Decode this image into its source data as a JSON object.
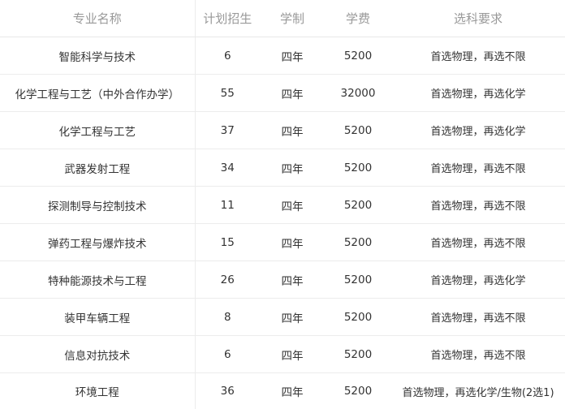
{
  "table": {
    "headers": [
      "专业名称",
      "计划招生",
      "学制",
      "学费",
      "选科要求"
    ],
    "rows": [
      {
        "name": "智能科学与技术",
        "plan": "6",
        "duration": "四年",
        "tuition": "5200",
        "requirement": "首选物理，再选不限"
      },
      {
        "name": "化学工程与工艺（中外合作办学）",
        "plan": "55",
        "duration": "四年",
        "tuition": "32000",
        "requirement": "首选物理，再选化学"
      },
      {
        "name": "化学工程与工艺",
        "plan": "37",
        "duration": "四年",
        "tuition": "5200",
        "requirement": "首选物理，再选化学"
      },
      {
        "name": "武器发射工程",
        "plan": "34",
        "duration": "四年",
        "tuition": "5200",
        "requirement": "首选物理，再选不限"
      },
      {
        "name": "探测制导与控制技术",
        "plan": "11",
        "duration": "四年",
        "tuition": "5200",
        "requirement": "首选物理，再选不限"
      },
      {
        "name": "弹药工程与爆炸技术",
        "plan": "15",
        "duration": "四年",
        "tuition": "5200",
        "requirement": "首选物理，再选不限"
      },
      {
        "name": "特种能源技术与工程",
        "plan": "26",
        "duration": "四年",
        "tuition": "5200",
        "requirement": "首选物理，再选化学"
      },
      {
        "name": "装甲车辆工程",
        "plan": "8",
        "duration": "四年",
        "tuition": "5200",
        "requirement": "首选物理，再选不限"
      },
      {
        "name": "信息对抗技术",
        "plan": "6",
        "duration": "四年",
        "tuition": "5200",
        "requirement": "首选物理，再选不限"
      },
      {
        "name": "环境工程",
        "plan": "36",
        "duration": "四年",
        "tuition": "5200",
        "requirement": "首选物理，再选化学/生物(2选1)"
      }
    ]
  }
}
